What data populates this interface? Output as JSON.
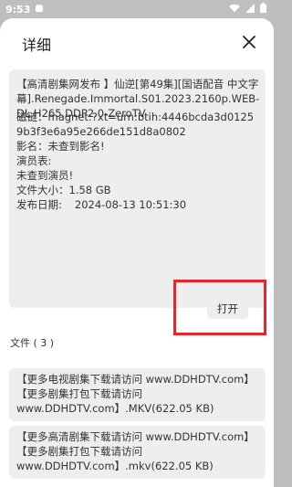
{
  "status_bar": {
    "time": "9:53"
  },
  "dialog": {
    "title": "详细",
    "info": {
      "title_text": "【高清剧集网发布 】仙逆[第49集][国语配音 中文字幕].Renegade.Immortal.S01.2023.2160p.WEB-DL.H265.DDP2.0-ZeroTV",
      "magnet_text": "磁链：magnet:?xt=urn:btih:4446bcda3d01259b3f3e6a95e266de151d8a0802",
      "name_text": "影名：未查到影名!",
      "actors_label": "演员表:",
      "actors_value": "未查到演员!",
      "size_text": "文件大小：1.58 GB",
      "date_label": "发布日期:",
      "date_value": "2024-08-13 10:51:30"
    },
    "open_button_label": "打开",
    "files_label": "文件 ( 3 )",
    "files": [
      {
        "line1": "【更多电视剧集下载请访问 www.DDHDTV.com】",
        "line2": "【更多剧集打包下载请访问",
        "line3": "www.DDHDTV.com】.MKV(622.05 KB)"
      },
      {
        "line1": "【更多高清剧集下载请访问 www.DDHDTV.com】",
        "line2": "【更多剧集打包下载请访问",
        "line3": "www.DDHDTV.com】.mkv(622.05 KB)"
      }
    ]
  }
}
